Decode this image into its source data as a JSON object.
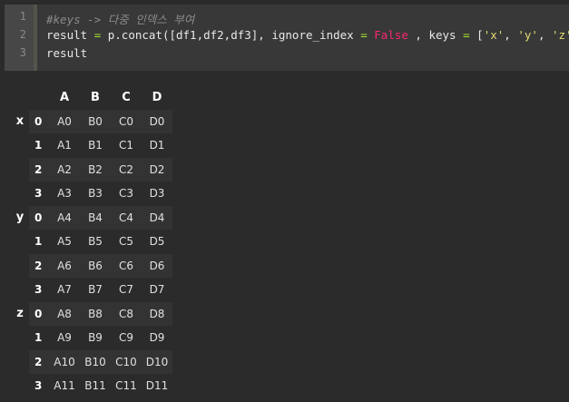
{
  "code": {
    "line_numbers": [
      "1",
      "2",
      "3"
    ],
    "line1_comment": "#keys -> 다중 인덱스 부여",
    "line2": {
      "p1": "result ",
      "eq1": "=",
      "p2": " p.concat([df1,df2,df3], ignore_index ",
      "eq2": "=",
      "sp": " ",
      "false_kw": "False",
      "p3": " , keys ",
      "eq3": "=",
      "p4": " [",
      "sx": "'x'",
      "c1": ", ",
      "sy": "'y'",
      "c2": ", ",
      "sz": "'z'",
      "p5": "])"
    },
    "line3": "result"
  },
  "table": {
    "columns": [
      "A",
      "B",
      "C",
      "D"
    ],
    "groups": [
      {
        "key": "x",
        "rows": [
          {
            "idx": "0",
            "cells": [
              "A0",
              "B0",
              "C0",
              "D0"
            ]
          },
          {
            "idx": "1",
            "cells": [
              "A1",
              "B1",
              "C1",
              "D1"
            ]
          },
          {
            "idx": "2",
            "cells": [
              "A2",
              "B2",
              "C2",
              "D2"
            ]
          },
          {
            "idx": "3",
            "cells": [
              "A3",
              "B3",
              "C3",
              "D3"
            ]
          }
        ]
      },
      {
        "key": "y",
        "rows": [
          {
            "idx": "0",
            "cells": [
              "A4",
              "B4",
              "C4",
              "D4"
            ]
          },
          {
            "idx": "1",
            "cells": [
              "A5",
              "B5",
              "C5",
              "D5"
            ]
          },
          {
            "idx": "2",
            "cells": [
              "A6",
              "B6",
              "C6",
              "D6"
            ]
          },
          {
            "idx": "3",
            "cells": [
              "A7",
              "B7",
              "C7",
              "D7"
            ]
          }
        ]
      },
      {
        "key": "z",
        "rows": [
          {
            "idx": "0",
            "cells": [
              "A8",
              "B8",
              "C8",
              "D8"
            ]
          },
          {
            "idx": "1",
            "cells": [
              "A9",
              "B9",
              "C9",
              "D9"
            ]
          },
          {
            "idx": "2",
            "cells": [
              "A10",
              "B10",
              "C10",
              "D10"
            ]
          },
          {
            "idx": "3",
            "cells": [
              "A11",
              "B11",
              "C11",
              "D11"
            ]
          }
        ]
      }
    ]
  }
}
